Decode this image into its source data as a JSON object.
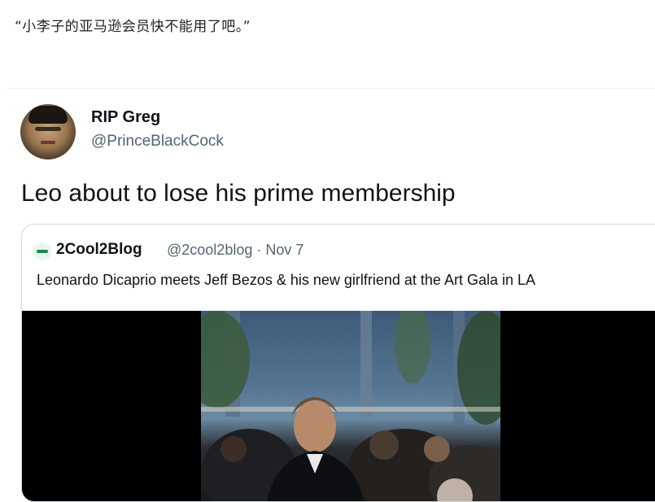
{
  "caption": "“小李子的亚马逊会员快不能用了吧。”",
  "tweet": {
    "display_name": "RIP Greg",
    "handle": "@PrinceBlackCock",
    "text": "Leo about to lose his prime membership"
  },
  "quoted_tweet": {
    "display_name": "2Cool2Blog",
    "meta": "@2cool2blog · Nov 7",
    "text": "Leonardo Dicaprio meets Jeff Bezos & his new girlfriend at the Art Gala in LA"
  },
  "colors": {
    "name_text": "#0f1419",
    "secondary_text": "#536471",
    "border": "#cfd9de",
    "quote_avatar_accent": "#1e8a4c"
  }
}
